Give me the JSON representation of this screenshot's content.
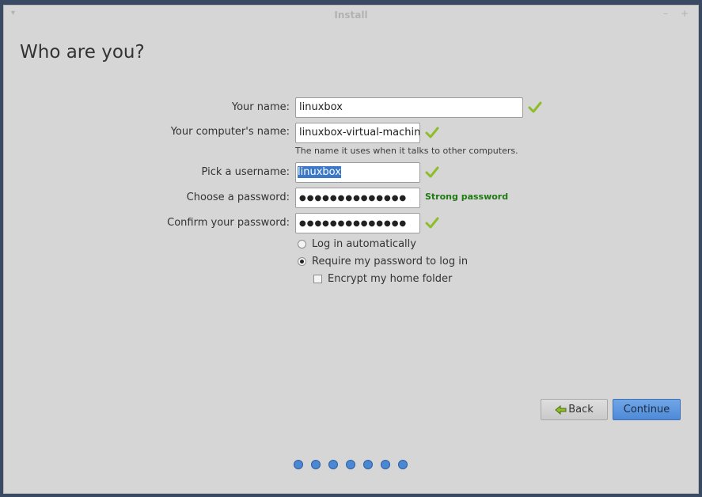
{
  "window": {
    "title": "Install",
    "menu_glyph": "▾",
    "minimize_glyph": "–",
    "maximize_glyph": "+"
  },
  "page": {
    "title": "Who are you?"
  },
  "form": {
    "your_name": {
      "label": "Your name:",
      "value": "linuxbox",
      "valid": true
    },
    "computer_name": {
      "label": "Your computer's name:",
      "value": "linuxbox-virtual-machine",
      "hint": "The name it uses when it talks to other computers.",
      "valid": true
    },
    "username": {
      "label": "Pick a username:",
      "value": "linuxbox",
      "selected": true,
      "valid": true
    },
    "password": {
      "label": "Choose a password:",
      "value": "●●●●●●●●●●●●●●",
      "strength": "Strong password"
    },
    "confirm": {
      "label": "Confirm your password:",
      "value": "●●●●●●●●●●●●●●",
      "valid": true
    }
  },
  "login_options": {
    "auto": {
      "label": "Log in automatically",
      "checked": false
    },
    "require": {
      "label": "Require my password to log in",
      "checked": true
    },
    "encrypt": {
      "label": "Encrypt my home folder",
      "checked": false
    }
  },
  "buttons": {
    "back": "Back",
    "continue": "Continue"
  },
  "progress": {
    "total_steps": 7
  },
  "colors": {
    "accent": "#4a88d4",
    "valid_check": "#8ebd2a",
    "strength_text": "#1f7a12",
    "selection": "#3b78c6"
  },
  "icons": {
    "valid": "checkmark-icon",
    "back": "back-arrow-icon"
  }
}
